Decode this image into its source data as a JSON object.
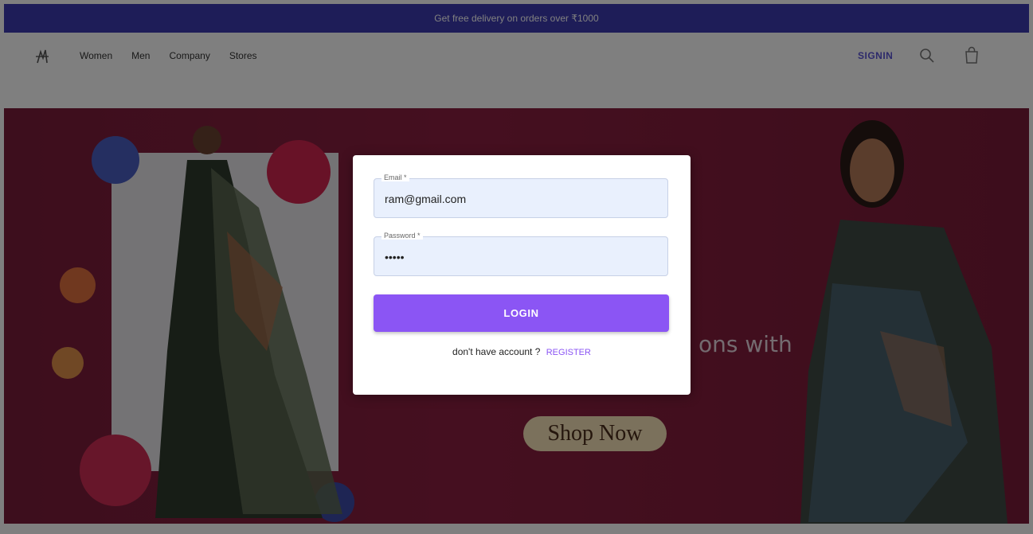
{
  "banner": {
    "text": "Get free delivery on orders over ₹1000"
  },
  "navbar": {
    "links": [
      "Women",
      "Men",
      "Company",
      "Stores"
    ],
    "signin_label": "SIGNIN",
    "icons": {
      "logo": "logo-icon",
      "search": "search-icon",
      "cart": "shopping-bag-icon"
    }
  },
  "hero": {
    "text_fragment": "ons with",
    "shop_button": "Shop Now"
  },
  "login_form": {
    "email": {
      "label": "Email *",
      "value": "ram@gmail.com"
    },
    "password": {
      "label": "Password *",
      "value": "•••••"
    },
    "login_button": "LOGIN",
    "register_prompt": "don't have account ?",
    "register_link": "REGISTER"
  },
  "colors": {
    "banner": "#3d3ab1",
    "hero_bg": "#8b1f40",
    "accent": "#8b55f4",
    "input_bg": "#e9f0fd"
  }
}
